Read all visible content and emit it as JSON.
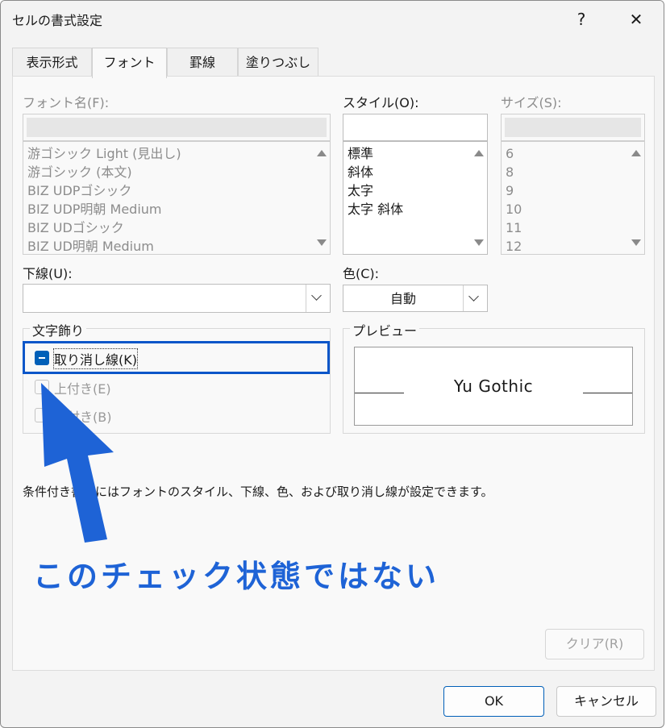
{
  "window": {
    "title": "セルの書式設定",
    "help": "?",
    "close": "✕"
  },
  "tabs": [
    {
      "label": "表示形式",
      "active": false
    },
    {
      "label": "フォント",
      "active": true
    },
    {
      "label": "罫線",
      "active": false
    },
    {
      "label": "塗りつぶし",
      "active": false
    }
  ],
  "font": {
    "label": "フォント名(F):",
    "input_value": "",
    "items": [
      "游ゴシック Light (見出し)",
      "游ゴシック (本文)",
      "BIZ UDPゴシック",
      "BIZ UDP明朝 Medium",
      "BIZ UDゴシック",
      "BIZ UD明朝 Medium"
    ]
  },
  "style": {
    "label": "スタイル(O):",
    "input_value": "",
    "items": [
      "標準",
      "斜体",
      "太字",
      "太字 斜体"
    ]
  },
  "size": {
    "label": "サイズ(S):",
    "input_value": "",
    "items": [
      "6",
      "8",
      "9",
      "10",
      "11",
      "12"
    ]
  },
  "underline": {
    "label": "下線(U):",
    "value": ""
  },
  "color": {
    "label": "色(C):",
    "value": "自動"
  },
  "effects": {
    "title": "文字飾り",
    "strikethrough": {
      "label": "取り消し線(K)",
      "state": "indeterminate"
    },
    "superscript": {
      "label": "上付き(E)",
      "state": "unchecked"
    },
    "subscript": {
      "label": "下付き(B)",
      "state": "unchecked"
    }
  },
  "preview": {
    "title": "プレビュー",
    "text": "Yu Gothic"
  },
  "note": "条件付き書式にはフォントのスタイル、下線、色、および取り消し線が設定できます。",
  "buttons": {
    "clear": "クリア(R)",
    "ok": "OK",
    "cancel": "キャンセル"
  },
  "annotation": {
    "text": "このチェック状態ではない",
    "color": "#1e63d6"
  },
  "colors": {
    "accent": "#005fb8",
    "highlight_border": "#0a56c9"
  }
}
